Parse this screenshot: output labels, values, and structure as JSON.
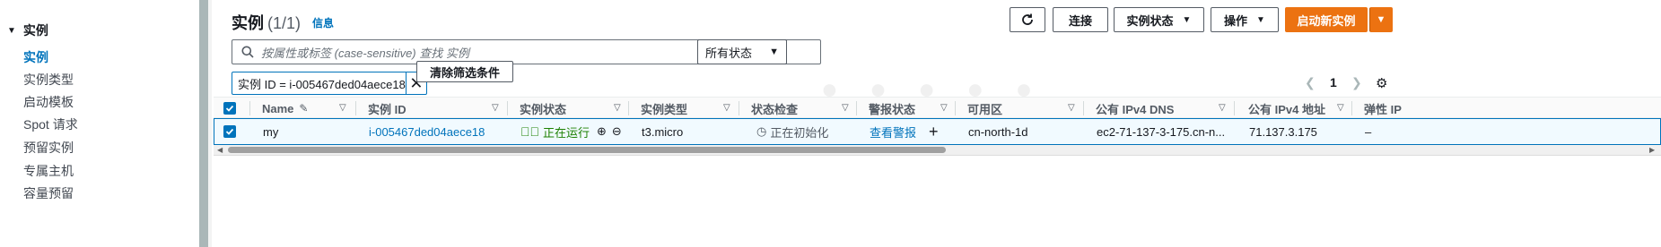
{
  "sidebar": {
    "header": "实例",
    "items": [
      {
        "label": "实例",
        "active": true
      },
      {
        "label": "实例类型"
      },
      {
        "label": "启动模板"
      },
      {
        "label": "Spot 请求"
      },
      {
        "label": "预留实例"
      },
      {
        "label": "专属主机"
      },
      {
        "label": "容量预留"
      }
    ]
  },
  "header": {
    "title": "实例",
    "count": "(1/1)",
    "info": "信息"
  },
  "toolbar": {
    "refresh_icon": "refresh-icon",
    "connect": "连接",
    "instance_state": "实例状态",
    "actions": "操作",
    "launch": "启动新实例"
  },
  "search": {
    "placeholder": "按属性或标签 (case-sensitive) 查找 实例",
    "state_filter": "所有状态"
  },
  "filter": {
    "chip": "实例 ID = i-005467ded04aece18",
    "clear": "清除筛选条件"
  },
  "pagination": {
    "page": "1"
  },
  "table": {
    "columns": [
      "Name",
      "实例 ID",
      "实例状态",
      "实例类型",
      "状态检查",
      "警报状态",
      "可用区",
      "公有 IPv4 DNS",
      "公有 IPv4 地址",
      "弹性 IP"
    ],
    "row": {
      "name": "my",
      "instance_id": "i-005467ded04aece18",
      "state": "正在运行",
      "type": "t3.micro",
      "status_check": "正在初始化",
      "alarm": "查看警报",
      "az": "cn-north-1d",
      "dns": "ec2-71-137-3-175.cn-n...",
      "ip": "71.137.3.175",
      "eip": "–"
    }
  },
  "colors": {
    "accent": "#0073bb",
    "primary": "#ec7211",
    "running": "#1d8102"
  }
}
